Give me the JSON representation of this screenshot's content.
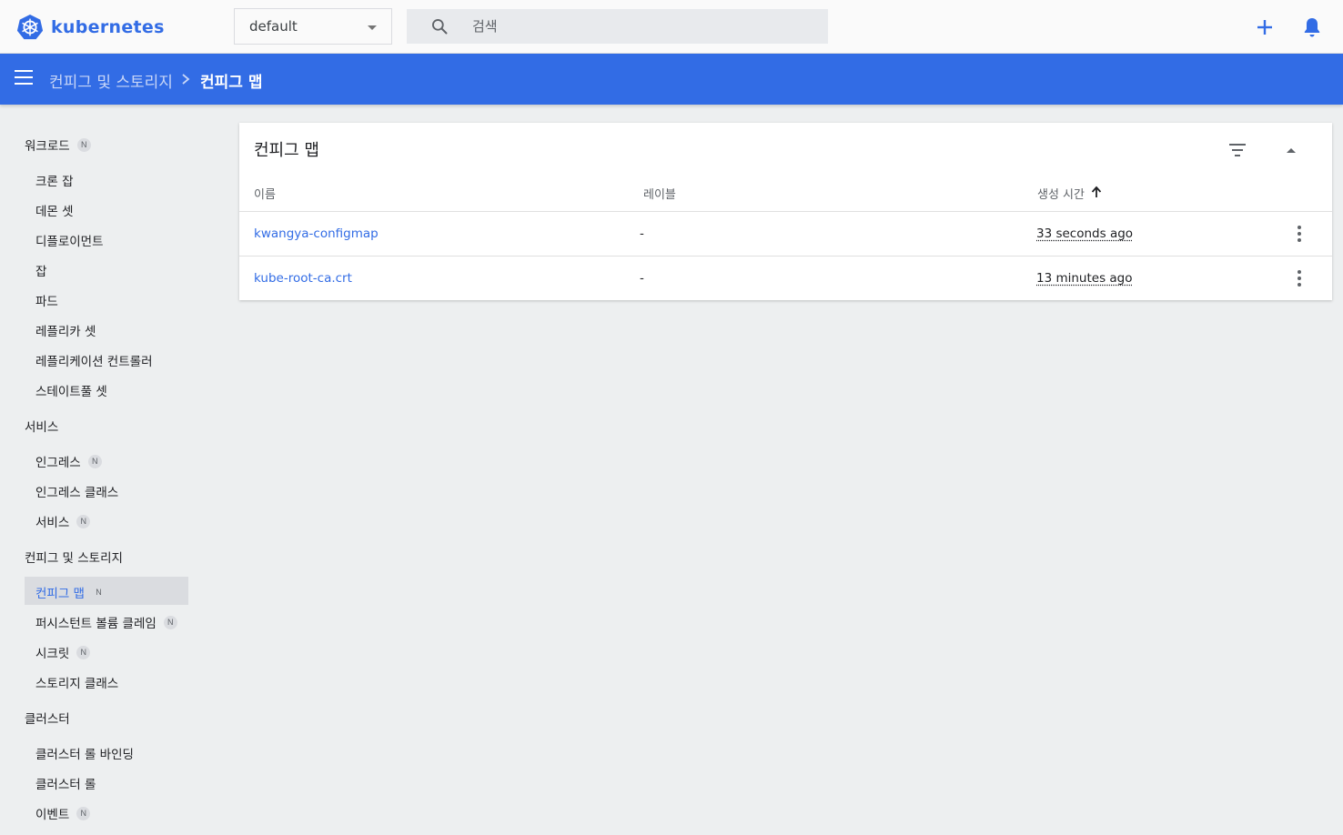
{
  "app": {
    "logo_text": "kubernetes",
    "namespace": "default",
    "search_placeholder": "검색"
  },
  "breadcrumb": {
    "parent": "컨피그 및 스토리지",
    "current": "컨피그 맵"
  },
  "sidebar": {
    "badge": "N",
    "workloads": {
      "label": "워크로드",
      "items": [
        "크론 잡",
        "데몬 셋",
        "디플로이먼트",
        "잡",
        "파드",
        "레플리카 셋",
        "레플리케이션 컨트롤러",
        "스테이트풀 셋"
      ]
    },
    "service": {
      "label": "서비스",
      "items": [
        "인그레스",
        "인그레스 클래스",
        "서비스"
      ]
    },
    "config": {
      "label": "컨피그 및 스토리지",
      "items": [
        "컨피그 맵",
        "퍼시스턴트 볼륨 클레임",
        "시크릿",
        "스토리지 클래스"
      ]
    },
    "cluster": {
      "label": "클러스터",
      "items": [
        "클러스터 롤 바인딩",
        "클러스터 롤",
        "이벤트"
      ]
    }
  },
  "card": {
    "title": "컨피그 맵",
    "columns": {
      "name": "이름",
      "labels": "레이블",
      "created": "생성 시간"
    },
    "rows": [
      {
        "name": "kwangya-configmap",
        "labels": "-",
        "created": "33 seconds ago"
      },
      {
        "name": "kube-root-ca.crt",
        "labels": "-",
        "created": "13 minutes ago"
      }
    ]
  },
  "colors": {
    "primary": "#326ce5",
    "background": "#edeff0"
  },
  "icons": [
    "kubernetes-logo-icon",
    "caret-down-icon",
    "search-icon",
    "plus-icon",
    "bell-icon",
    "menu-icon",
    "chevron-right-icon",
    "filter-icon",
    "collapse-icon",
    "sort-arrow-up-icon",
    "more-vert-icon"
  ]
}
